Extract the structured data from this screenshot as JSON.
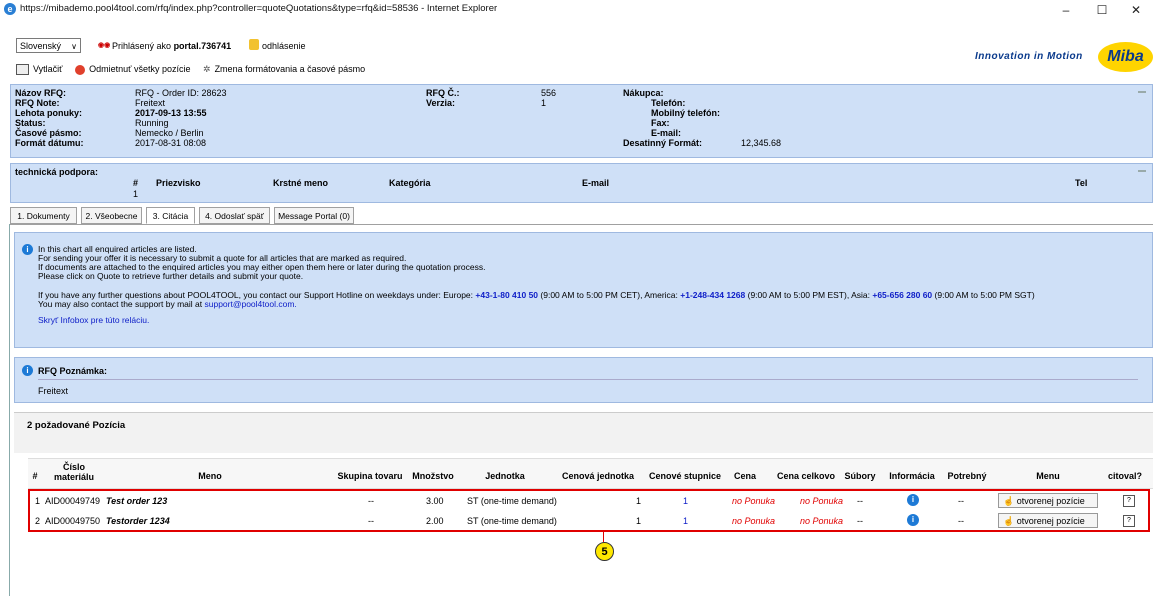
{
  "window": {
    "title": "https://mibademo.pool4tool.com/rfq/index.php?controller=quoteQuotations&type=rfq&id=58536 - Internet Explorer",
    "min": "–",
    "max": "☐",
    "close": "✕"
  },
  "header": {
    "language": "Slovenský",
    "logged_prefix": "Prihlásený ako",
    "logged_user": "portal.736741",
    "logout": "odhlásenie",
    "toolbar_print": "Vytlačiť",
    "toolbar_reject": "Odmietnuť všetky pozície",
    "toolbar_format": "Zmena formátovania a časové pásmo",
    "tagline": "Innovation in Motion",
    "logo": "Miba"
  },
  "rfq": {
    "labels": [
      "Názov RFQ:",
      "RFQ Note:",
      "Lehota ponuky:",
      "Status:",
      "Časové pásmo:",
      "Formát dátumu:"
    ],
    "values": [
      "RFQ - Order ID: 28623",
      "Freitext",
      "2017-09-13 13:55",
      "Running",
      "Nemecko / Berlin",
      "2017-08-31 08:08"
    ],
    "rfq_no_label": "RFQ Č.:",
    "rfq_no": "556",
    "version_label": "Verzia:",
    "version": "1",
    "buyer_labels": [
      "Nákupca:",
      "Telefón:",
      "Mobilný telefón:",
      "Fax:",
      "E-mail:",
      "Desatinný Formát:"
    ],
    "decimal_format": "12,345.68"
  },
  "support": {
    "title": "technická podpora:",
    "cols": [
      "#",
      "Priezvisko",
      "Krstné meno",
      "Kategória",
      "E-mail",
      "Tel"
    ],
    "row_no": "1"
  },
  "tabs": [
    "1. Dokumenty",
    "2. Všeobecne",
    "3. Citácia",
    "4. Odoslať späť",
    "Message Portal (0)"
  ],
  "infobox": {
    "line1": "In this chart all enquired articles are listed.",
    "line2": "For sending your offer it is necessary to submit a quote for all articles that are marked as required.",
    "line3": "If documents are attached to the enquired articles you may either open them here or later during the quotation process.",
    "line4": "Please click on Quote to retrieve further details and submit your quote.",
    "line5a": "If you have any further questions about POOL4TOOL, you contact our Support Hotline on weekdays under: Europe:",
    "phone_eu": "+43-1-80 410 50",
    "line5b": "(9:00 AM to 5:00 PM CET), America:",
    "phone_us": "+1-248-434 1268",
    "line5c": "(9:00 AM to 5:00 PM EST), Asia:",
    "phone_asia": "+65-656 280 60",
    "line5d": "(9:00 AM to 5:00 PM SGT)",
    "line6": "You may also contact the support by mail at",
    "support_mail": "support@pool4tool.com.",
    "hide_link": "Skryť Infobox pre túto reláciu."
  },
  "note": {
    "title": "RFQ Poznámka:",
    "text": "Freitext"
  },
  "positions": {
    "title": "2 požadované Pozícia",
    "headers": [
      "#",
      "Číslo materiálu",
      "Meno",
      "Skupina tovaru",
      "Množstvo",
      "Jednotka",
      "Cenová jednotka",
      "Cenové stupnice",
      "Cena",
      "Cena celkovo",
      "Súbory",
      "Informácia",
      "Potrebný",
      "Menu",
      "citoval?"
    ],
    "rows": [
      {
        "no": "1",
        "material": "AID00049749",
        "name": "Test order 123",
        "group": "--",
        "qty": "3.00",
        "unit": "ST (one-time demand)",
        "price_unit": "1",
        "scales": "1",
        "price": "no Ponuka",
        "total": "no Ponuka",
        "files": "--",
        "required": "--",
        "menu": "otvorenej pozície"
      },
      {
        "no": "2",
        "material": "AID00049750",
        "name": "Testorder 1234",
        "group": "--",
        "qty": "2.00",
        "unit": "ST (one-time demand)",
        "price_unit": "1",
        "scales": "1",
        "price": "no Ponuka",
        "total": "no Ponuka",
        "files": "--",
        "required": "--",
        "menu": "otvorenej pozície"
      }
    ]
  },
  "callout": "5"
}
